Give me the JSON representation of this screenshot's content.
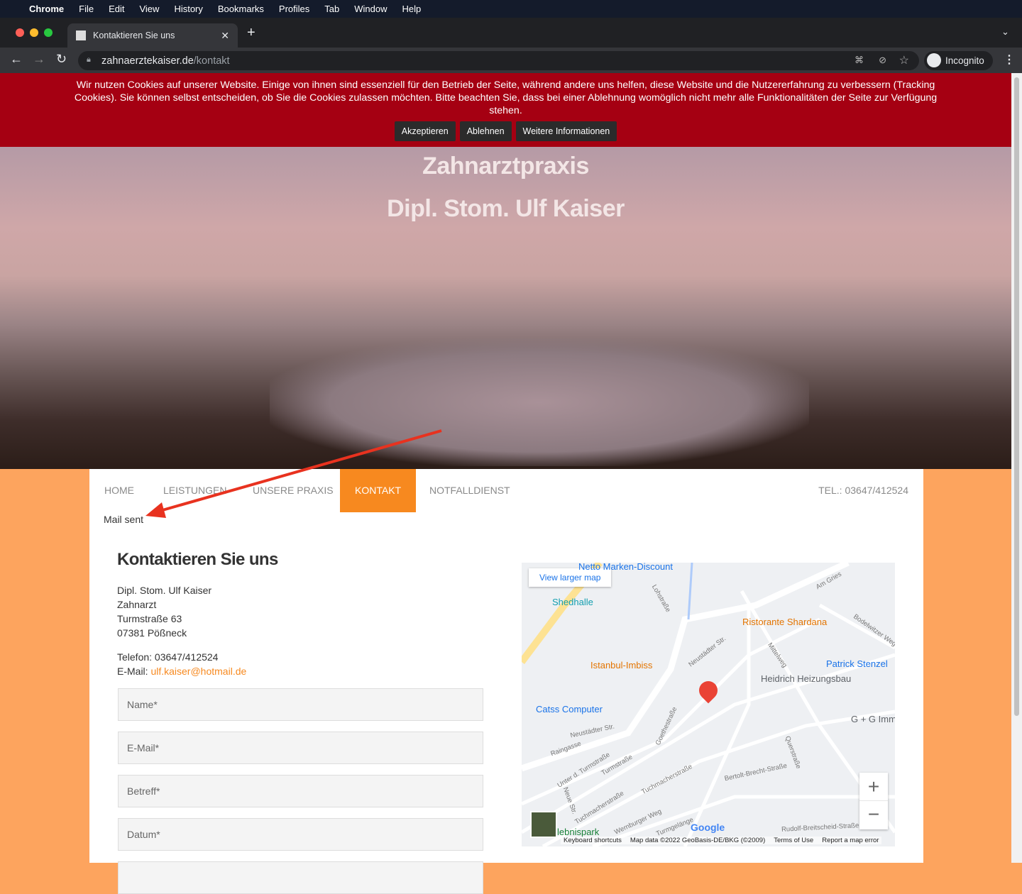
{
  "menubar": {
    "app": "Chrome",
    "items": [
      "File",
      "Edit",
      "View",
      "History",
      "Bookmarks",
      "Profiles",
      "Tab",
      "Window",
      "Help"
    ]
  },
  "browser": {
    "tab_title": "Kontaktieren Sie uns",
    "url_domain": "zahnaerztekaiser.de",
    "url_path": "/kontakt",
    "profile": "Incognito"
  },
  "cookie": {
    "text": "Wir nutzen Cookies auf unserer Website. Einige von ihnen sind essenziell für den Betrieb der Seite, während andere uns helfen, diese Website und die Nutzererfahrung zu verbessern (Tracking Cookies). Sie können selbst entscheiden, ob Sie die Cookies zulassen möchten. Bitte beachten Sie, dass bei einer Ablehnung womöglich nicht mehr alle Funktionalitäten der Seite zur Verfügung stehen.",
    "accept": "Akzeptieren",
    "decline": "Ablehnen",
    "more": "Weitere Informationen"
  },
  "hero": {
    "title": "Zahnarztpraxis",
    "subtitle": "Dipl. Stom. Ulf Kaiser"
  },
  "nav": {
    "items": [
      "HOME",
      "LEISTUNGEN",
      "UNSERE PRAXIS",
      "KONTAKT",
      "NOTFALLDIENST"
    ],
    "active": "KONTAKT",
    "phone": "TEL.: 03647/412524"
  },
  "status": "Mail sent",
  "contact": {
    "heading": "Kontaktieren Sie uns",
    "name": "Dipl. Stom. Ulf Kaiser",
    "profession": "Zahnarzt",
    "street": "Turmstraße 63",
    "city": "07381 Pößneck",
    "phone": "Telefon: 03647/412524",
    "email_label": "E-Mail: ",
    "email": "ulf.kaiser@hotmail.de"
  },
  "form": {
    "name": "Name*",
    "email": "E-Mail*",
    "subject": "Betreff*",
    "date": "Datum*"
  },
  "map": {
    "view_larger": "View larger map",
    "places": [
      "Netto Marken-Discount",
      "Shedhalle",
      "Ristorante Shardana",
      "Istanbul-Imbiss",
      "Patrick Stenzel",
      "Heidrich Heizungsbau",
      "Catss Computer",
      "G + G Imm",
      "lebnispark"
    ],
    "streets": [
      "Lohstraße",
      "Am Gries",
      "Bodelwitzer Weg",
      "Neustädter Str.",
      "Mittelweg",
      "Goethestraße",
      "Neustädter Str.",
      "Raingasse",
      "Unter d. Turmstraße",
      "Turmstraße",
      "Tuchmacherstraße",
      "Querstraße",
      "Bertolt-Brecht-Straße",
      "Tuchmacherstraße",
      "Neue Str.",
      "Wernburger Weg",
      "Turmgelänge",
      "Rudolf-Breitscheid-Straße"
    ],
    "zoom_in": "+",
    "zoom_out": "−",
    "logo": "Google",
    "attribution": [
      "Keyboard shortcuts",
      "Map data ©2022 GeoBasis-DE/BKG (©2009)",
      "Terms of Use",
      "Report a map error"
    ]
  },
  "colors": {
    "accent": "#f7891f",
    "banner": "#a50012",
    "page_bg": "#fda45e",
    "annotation_arrow": "#e8321f"
  }
}
